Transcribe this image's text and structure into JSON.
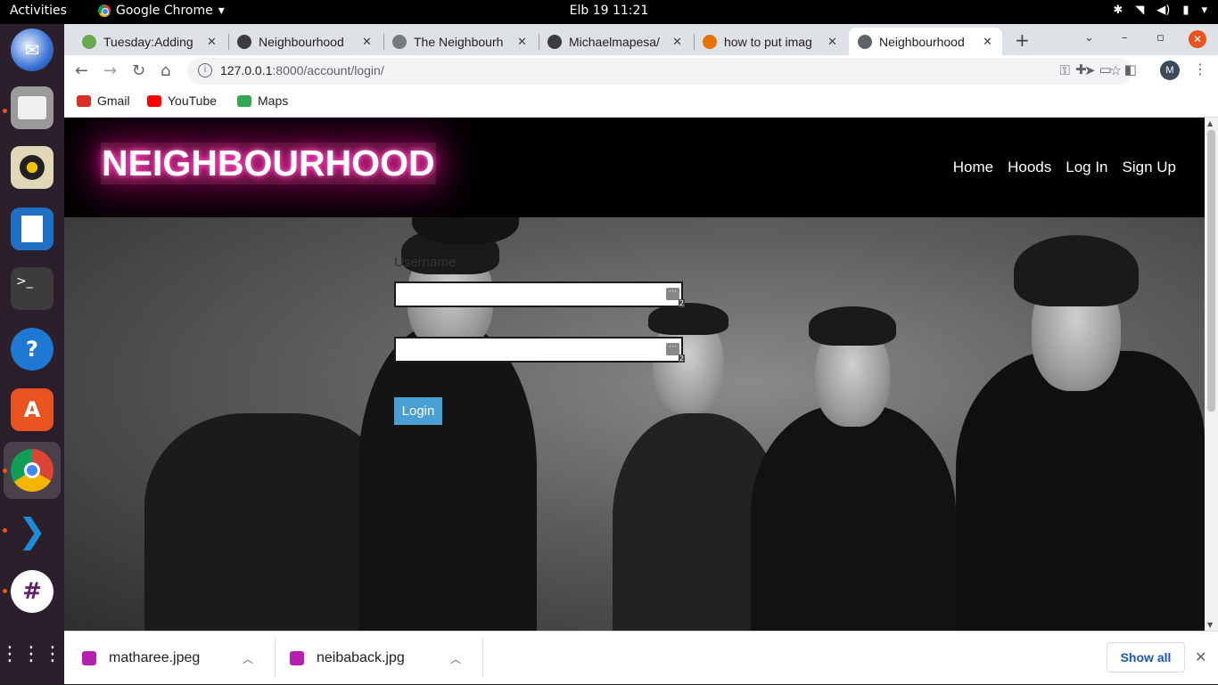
{
  "system_bar": {
    "activities": "Activities",
    "app_name": "Google Chrome",
    "clock": "Elb 19  11:21"
  },
  "tabs": [
    {
      "title": "Tuesday:Adding",
      "favicon_color": "#6aa84f"
    },
    {
      "title": "Neighbourhood",
      "favicon_color": "#3c3c3c"
    },
    {
      "title": "The Neighbourh",
      "favicon_color": "#7a7a7a"
    },
    {
      "title": "Michaelmapesa/",
      "favicon_color": "#3c3c3c"
    },
    {
      "title": "how to put imag",
      "favicon_color": "#e37400"
    },
    {
      "title": "Neighbourhood",
      "favicon_color": "#5f6368",
      "active": true
    }
  ],
  "address_bar": {
    "url_host": "127.0.0.1",
    "url_rest": ":8000/account/login/"
  },
  "bookmarks": [
    {
      "label": "Gmail",
      "color": "#d93025"
    },
    {
      "label": "YouTube",
      "color": "#ff0000"
    },
    {
      "label": "Maps",
      "color": "#34a853"
    }
  ],
  "site": {
    "brand": "NEIGHBOURHOOD",
    "nav": [
      "Home",
      "Hoods",
      "Log In",
      "Sign Up"
    ],
    "form": {
      "username_label": "Username",
      "username_value": "",
      "password_value": "",
      "login_button": "Login",
      "pwm_badge": "2"
    }
  },
  "downloads": [
    {
      "name": "matharee.jpeg"
    },
    {
      "name": "neibaback.jpg"
    }
  ],
  "show_all": "Show all",
  "profile_initial": "M",
  "colors": {
    "brand_glow": "#ff2fb0",
    "login_button": "#4a9fd4",
    "ubuntu_orange": "#e95420"
  }
}
